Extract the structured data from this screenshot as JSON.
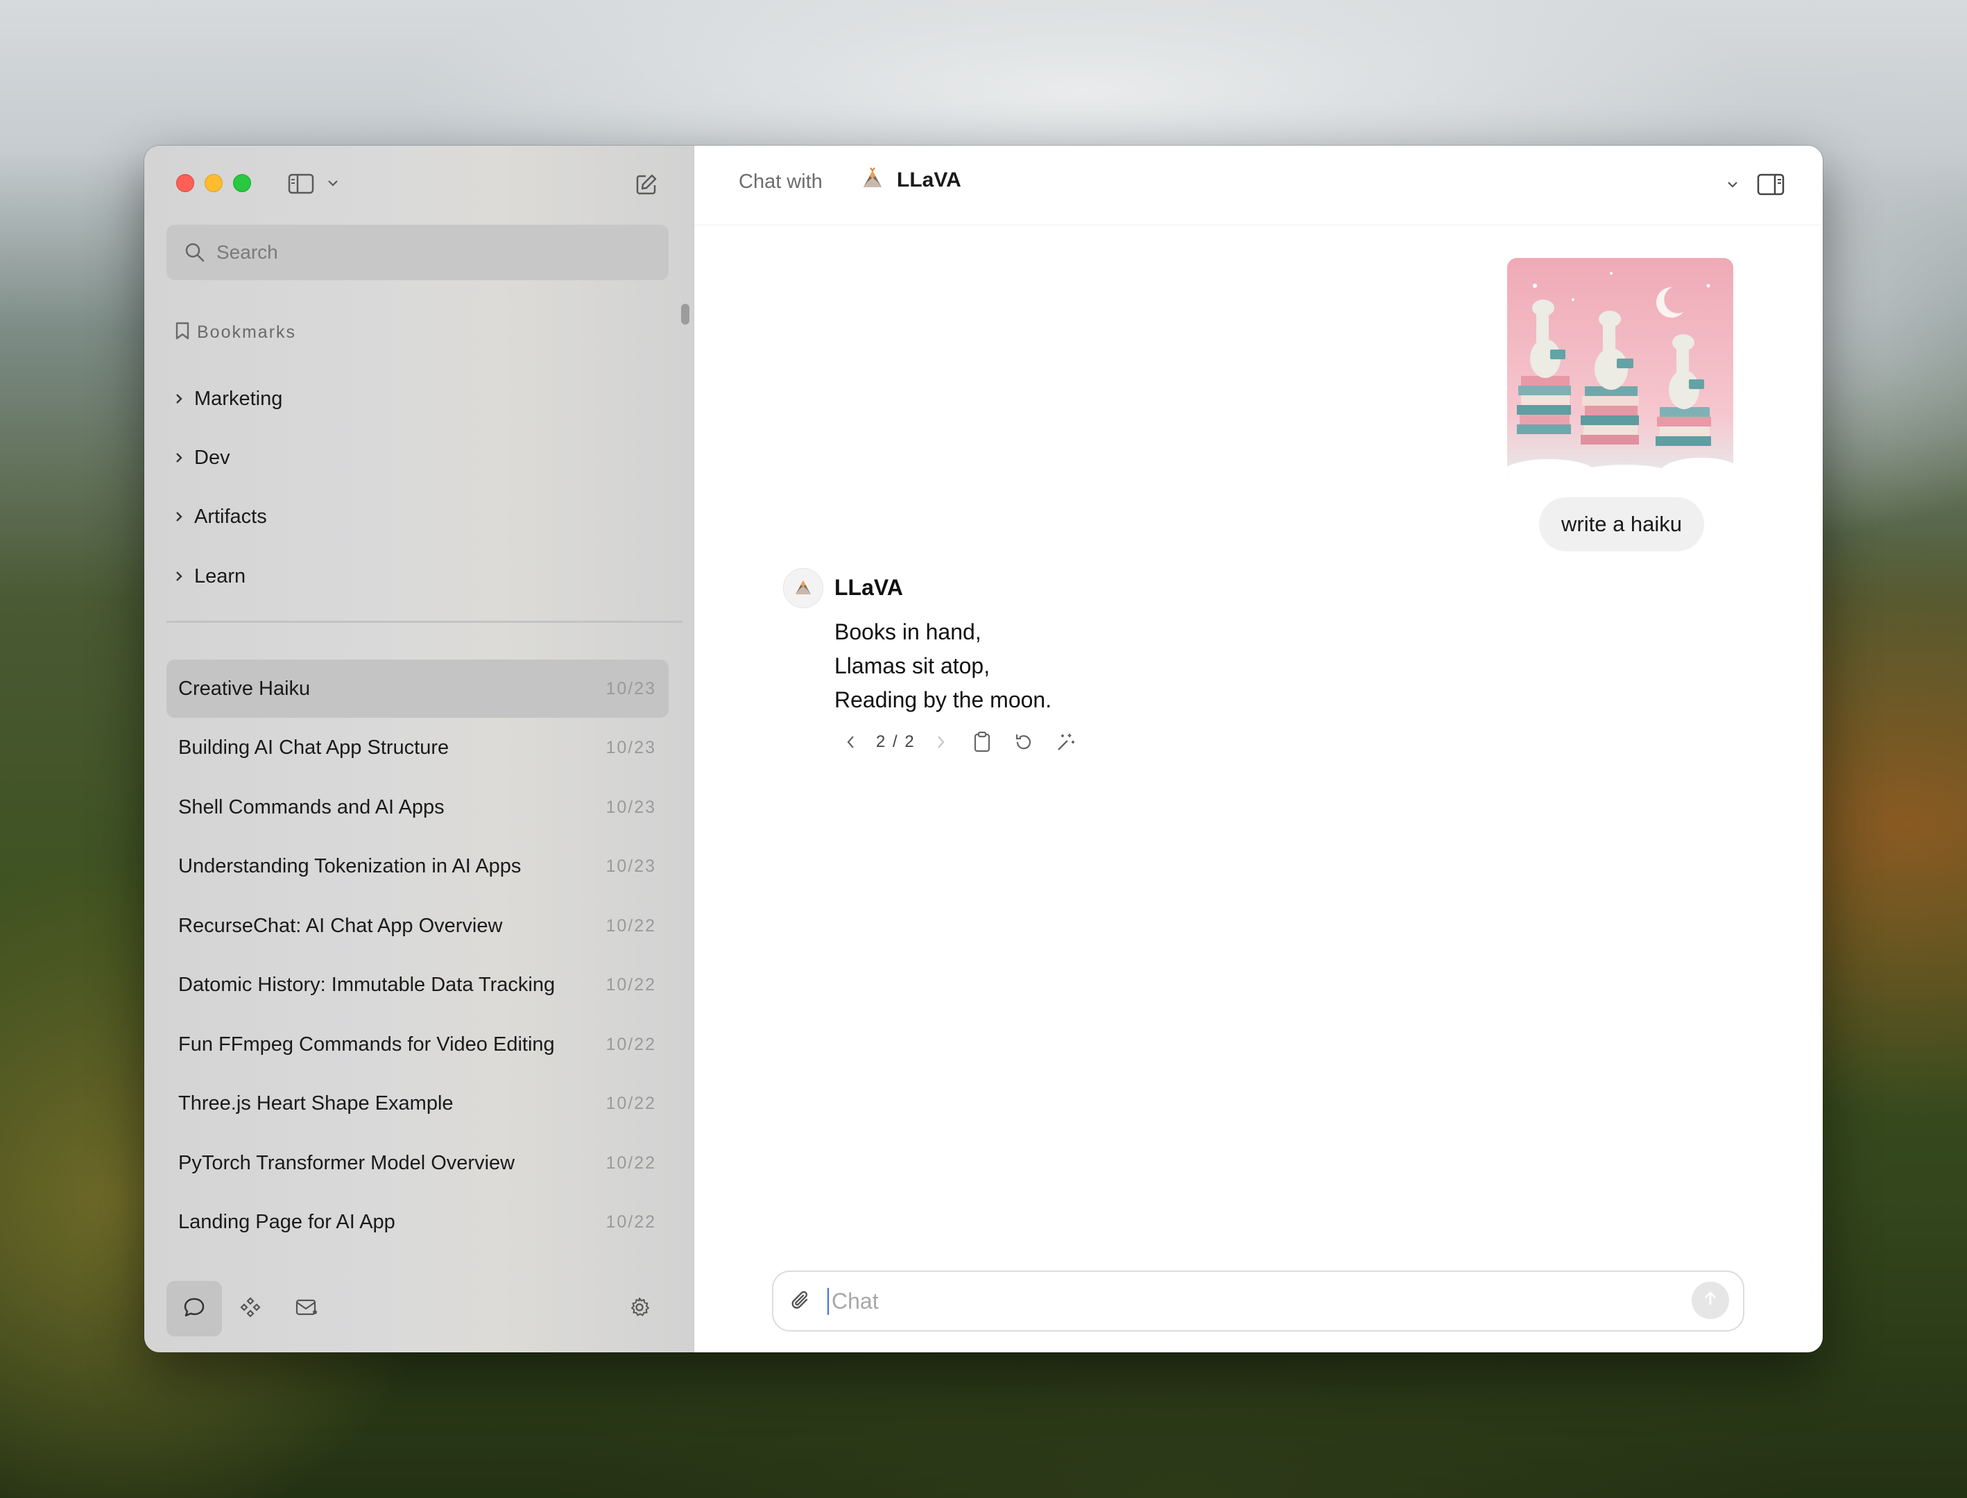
{
  "sidebar": {
    "search": {
      "placeholder": "Search"
    },
    "bookmarks_label": "Bookmarks",
    "folders": [
      {
        "label": "Marketing"
      },
      {
        "label": "Dev"
      },
      {
        "label": "Artifacts"
      },
      {
        "label": "Learn"
      }
    ],
    "chats": [
      {
        "title": "Creative Haiku",
        "date": "10/23",
        "active": true
      },
      {
        "title": "Building AI Chat App Structure",
        "date": "10/23"
      },
      {
        "title": "Shell Commands and AI Apps",
        "date": "10/23"
      },
      {
        "title": "Understanding Tokenization in AI Apps",
        "date": "10/23"
      },
      {
        "title": "RecurseChat: AI Chat App Overview",
        "date": "10/22"
      },
      {
        "title": "Datomic History: Immutable Data Tracking",
        "date": "10/22"
      },
      {
        "title": "Fun FFmpeg Commands for Video Editing",
        "date": "10/22"
      },
      {
        "title": "Three.js Heart Shape Example",
        "date": "10/22"
      },
      {
        "title": "PyTorch Transformer Model Overview",
        "date": "10/22"
      },
      {
        "title": "Landing Page for AI App",
        "date": "10/22"
      }
    ],
    "footer_icons": [
      "chat-icon",
      "models-icon",
      "mail-icon",
      "settings-icon"
    ]
  },
  "topbar": {
    "chat_with_label": "Chat with",
    "model_name": "LLaVA",
    "model_icon": "llava-volcano-icon"
  },
  "conversation": {
    "user_message": "write a haiku",
    "assistant_name": "LLaVA",
    "assistant_lines": [
      "Books in hand,",
      "Llamas sit atop,",
      "Reading by the moon."
    ],
    "version": "2 / 2"
  },
  "composer": {
    "placeholder": "Chat"
  },
  "colors": {
    "close": "#fe5f57",
    "minimize": "#febc2e",
    "zoom": "#28c840",
    "active_item": "#c4c4c4"
  }
}
